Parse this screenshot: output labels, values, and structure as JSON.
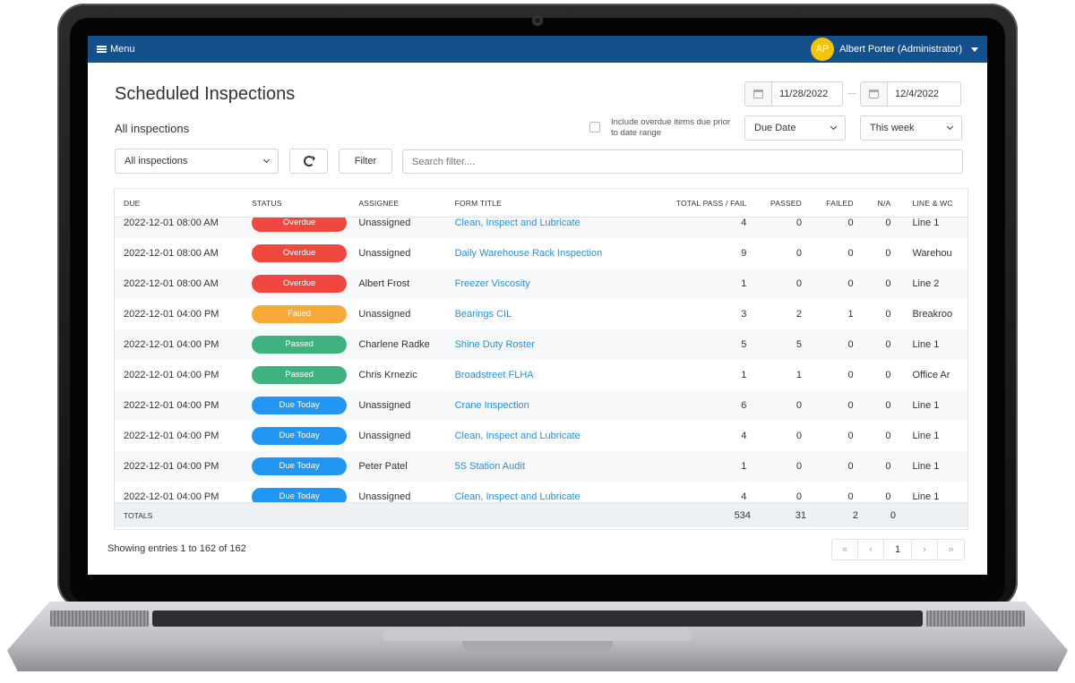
{
  "topbar": {
    "menu_label": "Menu",
    "user_initials": "AP",
    "user_name": "Albert Porter (Administrator)"
  },
  "page": {
    "title": "Scheduled Inspections",
    "subtitle": "All inspections"
  },
  "date_range": {
    "start": "11/28/2022",
    "end": "12/4/2022"
  },
  "overdue_option": {
    "label": "Include overdue items due prior to date range",
    "checked": false
  },
  "sort_select": {
    "value": "Due Date"
  },
  "period_select": {
    "value": "This week"
  },
  "filters": {
    "scope_value": "All inspections",
    "filter_button": "Filter",
    "search_placeholder": "Search filter...."
  },
  "table": {
    "columns": [
      "DUE",
      "STATUS",
      "ASSIGNEE",
      "FORM TITLE",
      "TOTAL PASS / FAIL",
      "PASSED",
      "FAILED",
      "N/A",
      "LINE & WC"
    ],
    "rows": [
      {
        "due": "2022-12-01 08:00 AM",
        "status": "Overdue",
        "assignee": "Unassigned",
        "form": "Clean, Inspect and Lubricate",
        "total": "4",
        "passed": "0",
        "failed": "0",
        "na": "0",
        "line": "Line 1"
      },
      {
        "due": "2022-12-01 08:00 AM",
        "status": "Overdue",
        "assignee": "Unassigned",
        "form": "Daily Warehouse Rack Inspection",
        "total": "9",
        "passed": "0",
        "failed": "0",
        "na": "0",
        "line": "Warehou"
      },
      {
        "due": "2022-12-01 08:00 AM",
        "status": "Overdue",
        "assignee": "Albert Frost",
        "form": "Freezer Viscosity",
        "total": "1",
        "passed": "0",
        "failed": "0",
        "na": "0",
        "line": "Line 2"
      },
      {
        "due": "2022-12-01 04:00 PM",
        "status": "Failed",
        "assignee": "Unassigned",
        "form": "Bearings CIL",
        "total": "3",
        "passed": "2",
        "failed": "1",
        "na": "0",
        "line": "Breakroo"
      },
      {
        "due": "2022-12-01 04:00 PM",
        "status": "Passed",
        "assignee": "Charlene Radke",
        "form": "Shine Duty Roster",
        "total": "5",
        "passed": "5",
        "failed": "0",
        "na": "0",
        "line": "Line 1"
      },
      {
        "due": "2022-12-01 04:00 PM",
        "status": "Passed",
        "assignee": "Chris Krnezic",
        "form": "Broadstreet FLHA",
        "total": "1",
        "passed": "1",
        "failed": "0",
        "na": "0",
        "line": "Office Ar"
      },
      {
        "due": "2022-12-01 04:00 PM",
        "status": "Due Today",
        "assignee": "Unassigned",
        "form": "Crane Inspection",
        "total": "6",
        "passed": "0",
        "failed": "0",
        "na": "0",
        "line": "Line 1"
      },
      {
        "due": "2022-12-01 04:00 PM",
        "status": "Due Today",
        "assignee": "Unassigned",
        "form": "Clean, Inspect and Lubricate",
        "total": "4",
        "passed": "0",
        "failed": "0",
        "na": "0",
        "line": "Line 1"
      },
      {
        "due": "2022-12-01 04:00 PM",
        "status": "Due Today",
        "assignee": "Peter Patel",
        "form": "5S Station Audit",
        "total": "1",
        "passed": "0",
        "failed": "0",
        "na": "0",
        "line": "Line 1"
      },
      {
        "due": "2022-12-01 04:00 PM",
        "status": "Due Today",
        "assignee": "Unassigned",
        "form": "Clean, Inspect and Lubricate",
        "total": "4",
        "passed": "0",
        "failed": "0",
        "na": "0",
        "line": "Line 1"
      }
    ],
    "totals": {
      "label": "TOTALS",
      "total": "534",
      "passed": "31",
      "failed": "2",
      "na": "0"
    }
  },
  "status_colors": {
    "Overdue": "#f0483e",
    "Failed": "#f9a93a",
    "Passed": "#3fb27f",
    "Due Today": "#2196f3"
  },
  "footer": {
    "entries_text": "Showing entries 1 to 162 of 162",
    "pages": [
      "«",
      "‹",
      "1",
      "›",
      "»"
    ]
  }
}
